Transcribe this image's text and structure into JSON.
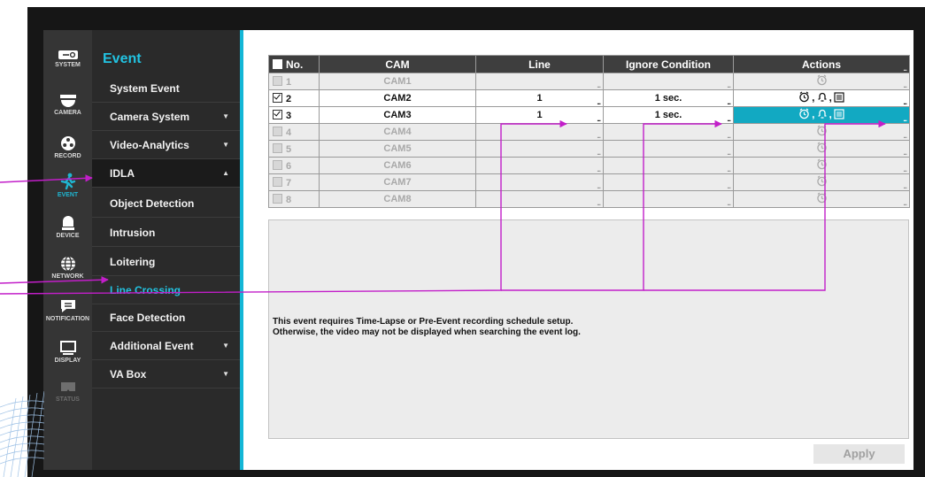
{
  "rail": [
    {
      "name": "rail-system",
      "label": "SYSTEM",
      "icon": "toggle-icon"
    },
    {
      "name": "rail-camera",
      "label": "CAMERA",
      "icon": "dome-camera-icon"
    },
    {
      "name": "rail-record",
      "label": "RECORD",
      "icon": "reel-icon"
    },
    {
      "name": "rail-event",
      "label": "EVENT",
      "icon": "running-person-icon"
    },
    {
      "name": "rail-device",
      "label": "DEVICE",
      "icon": "device-icon"
    },
    {
      "name": "rail-network",
      "label": "NETWORK",
      "icon": "globe-icon"
    },
    {
      "name": "rail-notification",
      "label": "NOTIFICATION",
      "icon": "chat-bubble-icon"
    },
    {
      "name": "rail-display",
      "label": "DISPLAY",
      "icon": "monitor-icon"
    },
    {
      "name": "rail-status",
      "label": "STATUS",
      "icon": "status-icon"
    }
  ],
  "menu": {
    "title": "Event",
    "items": [
      {
        "label": "System Event",
        "caret": ""
      },
      {
        "label": "Camera System",
        "caret": "▼"
      },
      {
        "label": "Video-Analytics",
        "caret": "▼"
      },
      {
        "label": "IDLA",
        "caret": "▲"
      },
      {
        "label": "Object Detection",
        "caret": ""
      },
      {
        "label": "Intrusion",
        "caret": ""
      },
      {
        "label": "Loitering",
        "caret": ""
      },
      {
        "label": "Line Crossing",
        "caret": ""
      },
      {
        "label": "Face Detection",
        "caret": ""
      },
      {
        "label": "Additional Event",
        "caret": "▼"
      },
      {
        "label": "VA Box",
        "caret": "▼"
      }
    ]
  },
  "table": {
    "headers": {
      "no": "No.",
      "cam": "CAM",
      "line": "Line",
      "ignore": "Ignore Condition",
      "actions": "Actions"
    },
    "more": "...",
    "rows": [
      {
        "no": "1",
        "cam": "CAM1",
        "line": "",
        "ignore": "",
        "checked": false
      },
      {
        "no": "2",
        "cam": "CAM2",
        "line": "1",
        "ignore": "1 sec.",
        "checked": true
      },
      {
        "no": "3",
        "cam": "CAM3",
        "line": "1",
        "ignore": "1 sec.",
        "checked": true
      },
      {
        "no": "4",
        "cam": "CAM4",
        "line": "",
        "ignore": "",
        "checked": false
      },
      {
        "no": "5",
        "cam": "CAM5",
        "line": "",
        "ignore": "",
        "checked": false
      },
      {
        "no": "6",
        "cam": "CAM6",
        "line": "",
        "ignore": "",
        "checked": false
      },
      {
        "no": "7",
        "cam": "CAM7",
        "line": "",
        "ignore": "",
        "checked": false
      },
      {
        "no": "8",
        "cam": "CAM8",
        "line": "",
        "ignore": "",
        "checked": false
      }
    ],
    "action_sep": ","
  },
  "notice": {
    "line1": "This event requires Time-Lapse or Pre-Event recording schedule setup.",
    "line2": "Otherwise, the video may not be displayed when searching the event log."
  },
  "apply_label": "Apply",
  "colors": {
    "accent": "#14b6d6",
    "annotation": "#c21ec9"
  }
}
